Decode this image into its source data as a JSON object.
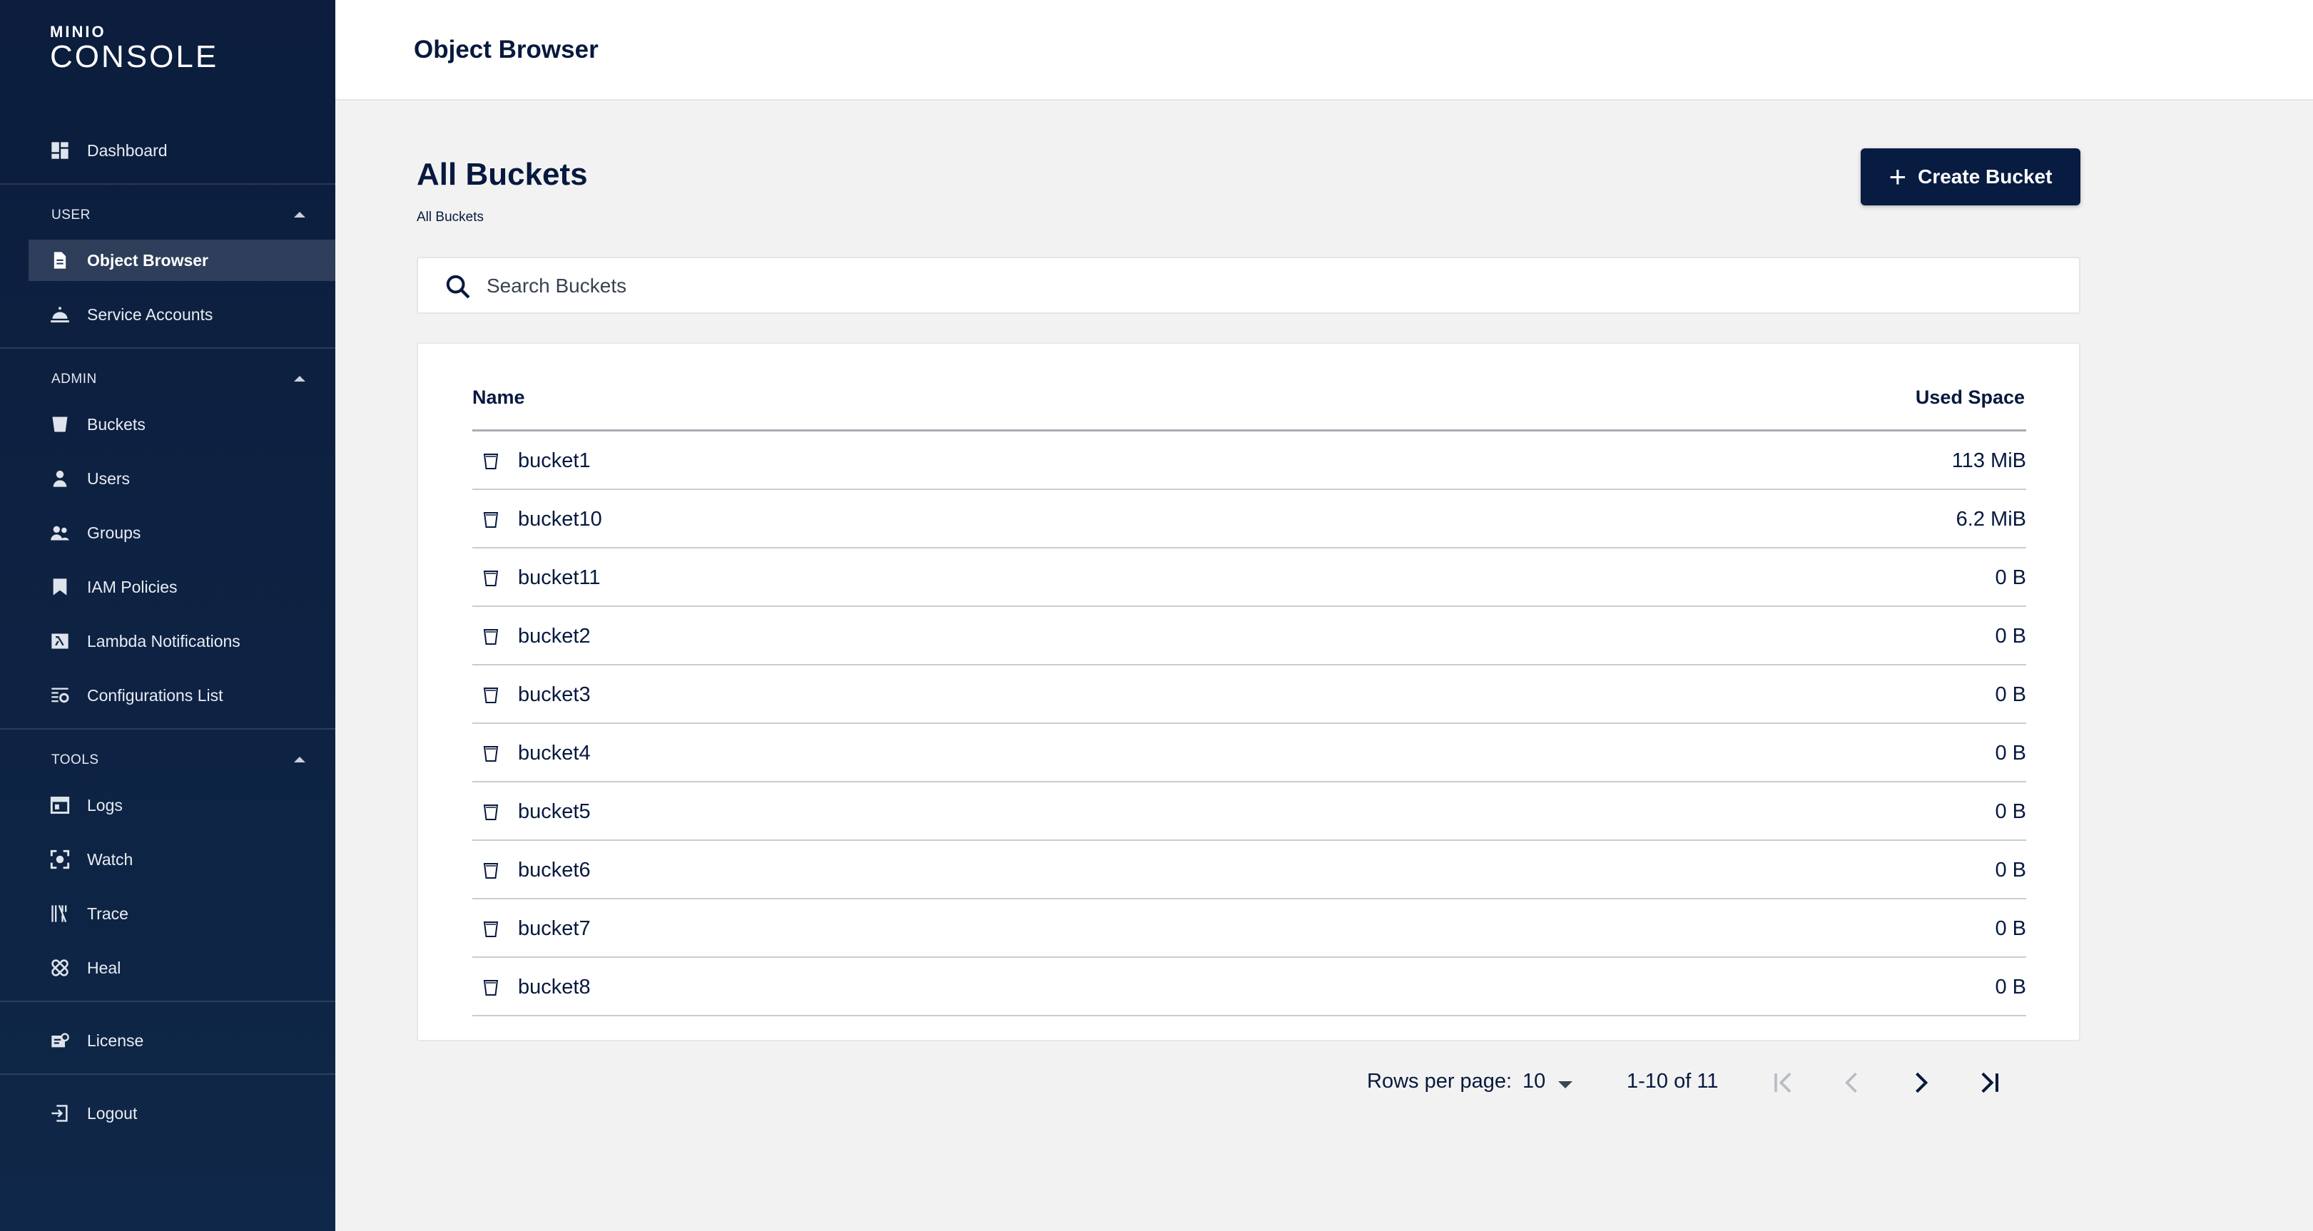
{
  "brand": {
    "small": "MINIO",
    "big": "CONSOLE"
  },
  "header": {
    "title": "Object Browser"
  },
  "sidebar": {
    "dashboard": {
      "label": "Dashboard",
      "icon": "dashboard-icon"
    },
    "sections": [
      {
        "title": "USER",
        "items": [
          {
            "label": "Object Browser",
            "icon": "document-icon",
            "selected": true
          },
          {
            "label": "Service Accounts",
            "icon": "service-bell-icon"
          }
        ]
      },
      {
        "title": "ADMIN",
        "items": [
          {
            "label": "Buckets",
            "icon": "bucket-icon"
          },
          {
            "label": "Users",
            "icon": "user-icon"
          },
          {
            "label": "Groups",
            "icon": "groups-icon"
          },
          {
            "label": "IAM Policies",
            "icon": "bookmark-icon"
          },
          {
            "label": "Lambda Notifications",
            "icon": "lambda-icon"
          },
          {
            "label": "Configurations List",
            "icon": "config-list-icon"
          }
        ]
      },
      {
        "title": "TOOLS",
        "items": [
          {
            "label": "Logs",
            "icon": "logs-icon"
          },
          {
            "label": "Watch",
            "icon": "watch-icon"
          },
          {
            "label": "Trace",
            "icon": "trace-icon"
          },
          {
            "label": "Heal",
            "icon": "heal-icon"
          }
        ]
      }
    ],
    "license": {
      "label": "License",
      "icon": "license-icon"
    },
    "logout": {
      "label": "Logout",
      "icon": "logout-icon"
    }
  },
  "main": {
    "heading": "All Buckets",
    "breadcrumb": "All Buckets",
    "create_button": "Create Bucket",
    "search": {
      "placeholder": "Search Buckets",
      "value": ""
    },
    "table": {
      "columns": [
        "Name",
        "Used Space"
      ],
      "rows": [
        {
          "name": "bucket1",
          "size": "113 MiB"
        },
        {
          "name": "bucket10",
          "size": "6.2 MiB"
        },
        {
          "name": "bucket11",
          "size": "0 B"
        },
        {
          "name": "bucket2",
          "size": "0 B"
        },
        {
          "name": "bucket3",
          "size": "0 B"
        },
        {
          "name": "bucket4",
          "size": "0 B"
        },
        {
          "name": "bucket5",
          "size": "0 B"
        },
        {
          "name": "bucket6",
          "size": "0 B"
        },
        {
          "name": "bucket7",
          "size": "0 B"
        },
        {
          "name": "bucket8",
          "size": "0 B"
        }
      ]
    },
    "pagination": {
      "rows_per_page_label": "Rows per page:",
      "rows_per_page": "10",
      "range": "1-10 of 11"
    }
  },
  "colors": {
    "sidebar_bg": "#0c1d3d",
    "accent": "#081c42",
    "page_bg": "#f2f2f2"
  }
}
